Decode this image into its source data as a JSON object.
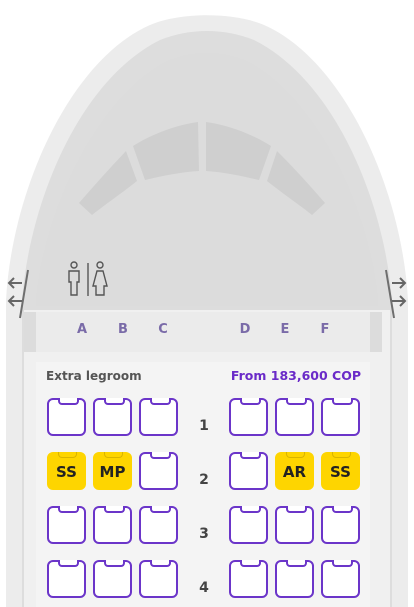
{
  "columns": [
    "A",
    "B",
    "C",
    "D",
    "E",
    "F"
  ],
  "extra_legroom_label": "Extra legroom",
  "price_label": "From 183,600 COP",
  "rows": [
    {
      "number": "1",
      "seats": [
        {
          "code": ""
        },
        {
          "code": ""
        },
        {
          "code": ""
        },
        {
          "code": ""
        },
        {
          "code": ""
        },
        {
          "code": ""
        }
      ]
    },
    {
      "number": "2",
      "seats": [
        {
          "code": "SS"
        },
        {
          "code": "MP"
        },
        {
          "code": ""
        },
        {
          "code": ""
        },
        {
          "code": "AR"
        },
        {
          "code": "SS"
        }
      ]
    },
    {
      "number": "3",
      "seats": [
        {
          "code": ""
        },
        {
          "code": ""
        },
        {
          "code": ""
        },
        {
          "code": ""
        },
        {
          "code": ""
        },
        {
          "code": ""
        }
      ]
    },
    {
      "number": "4",
      "seats": [
        {
          "code": ""
        },
        {
          "code": ""
        },
        {
          "code": ""
        },
        {
          "code": ""
        },
        {
          "code": ""
        },
        {
          "code": ""
        }
      ]
    }
  ],
  "icons": {
    "exit_left": "exit-arrows-icon",
    "exit_right": "exit-arrows-icon",
    "restroom": "restroom-icon"
  },
  "colors": {
    "seat_border": "#6b35c9",
    "occupied": "#fed500",
    "price": "#6a2ac8",
    "column_label": "#7a6ba8"
  }
}
